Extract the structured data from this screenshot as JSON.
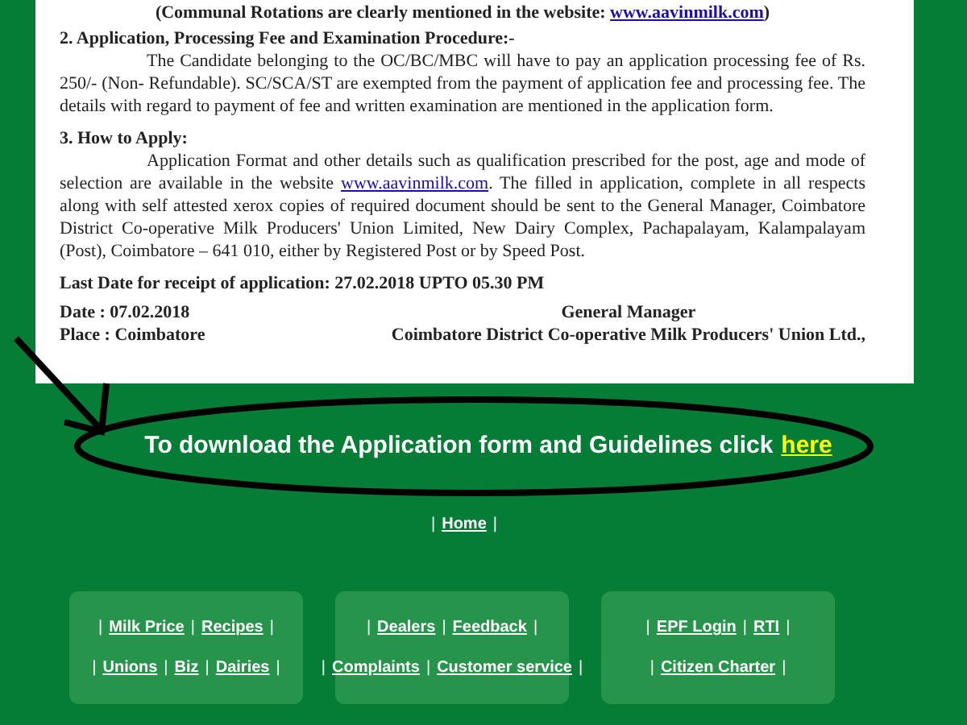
{
  "document": {
    "top_line": {
      "text_before": "(Communal Rotations are clearly mentioned in the website: ",
      "link": "www.aavinmilk.com",
      "text_after": ")"
    },
    "sections": [
      {
        "heading": "2. Application, Processing Fee and Examination Procedure:-",
        "text_before": "The Candidate belonging to the OC/BC/MBC will have to pay an application processing fee of Rs. 250/- (Non- Refundable). SC/SCA/ST are exempted from the payment of application fee and processing fee. The details with regard to payment of fee and written examination are mentioned in the application form."
      },
      {
        "heading": "3. How to Apply:",
        "text_before": "Application Format and other details such as qualification prescribed for the post, age and mode of selection are available in the website ",
        "link": "www.aavinmilk.com",
        "text_after": ". The filled in application, complete in all respects along with self attested xerox copies of required document should be sent to the General Manager, Coimbatore District Co-operative Milk Producers' Union Limited, New Dairy Complex, Pachapalayam, Kalampalayam (Post),  Coimbatore – 641 010, either by Registered Post or by Speed Post."
      }
    ],
    "last_date": "Last Date for receipt of application:  27.02.2018  UPTO 05.30 PM",
    "date": "Date : 07.02.2018",
    "signatory_title": "General Manager",
    "place": "Place : Coimbatore",
    "signatory_org": "Coimbatore District Co-operative Milk Producers' Union Ltd.,"
  },
  "download": {
    "text": "To download the Application form and Guidelines click",
    "link": "here"
  },
  "home_nav": [
    {
      "kind": "separator",
      "text": "|"
    },
    {
      "kind": "link",
      "text": "Home"
    },
    {
      "kind": "separator",
      "text": "|"
    }
  ],
  "footer_boxes": [
    {
      "lines": [
        {
          "items": [
            {
              "kind": "separator",
              "text": "|"
            },
            {
              "kind": "link",
              "text": "Milk Price"
            },
            {
              "kind": "separator",
              "text": "|"
            },
            {
              "kind": "link",
              "text": "Recipes"
            },
            {
              "kind": "separator",
              "text": "|"
            }
          ]
        },
        {
          "items": [
            {
              "kind": "separator",
              "text": "|"
            },
            {
              "kind": "link",
              "text": "Unions"
            },
            {
              "kind": "separator",
              "text": "|"
            },
            {
              "kind": "link",
              "text": "Biz"
            },
            {
              "kind": "separator",
              "text": "|"
            },
            {
              "kind": "link",
              "text": "Dairies"
            },
            {
              "kind": "separator",
              "text": "|"
            }
          ]
        }
      ]
    },
    {
      "lines": [
        {
          "items": [
            {
              "kind": "separator",
              "text": "|"
            },
            {
              "kind": "link",
              "text": "Dealers"
            },
            {
              "kind": "separator",
              "text": "|"
            },
            {
              "kind": "link",
              "text": "Feedback"
            },
            {
              "kind": "separator",
              "text": "|"
            }
          ]
        },
        {
          "items": [
            {
              "kind": "separator",
              "text": "|"
            },
            {
              "kind": "link",
              "text": "Complaints"
            },
            {
              "kind": "separator",
              "text": "|"
            },
            {
              "kind": "link",
              "text": "Customer service"
            },
            {
              "kind": "separator",
              "text": "|"
            }
          ]
        }
      ]
    },
    {
      "lines": [
        {
          "items": [
            {
              "kind": "separator",
              "text": "|"
            },
            {
              "kind": "link",
              "text": "EPF Login"
            },
            {
              "kind": "separator",
              "text": "|"
            },
            {
              "kind": "link",
              "text": "RTI"
            },
            {
              "kind": "separator",
              "text": "|"
            }
          ]
        },
        {
          "items": [
            {
              "kind": "separator",
              "text": "|"
            },
            {
              "kind": "link",
              "text": "Citizen Charter"
            },
            {
              "kind": "separator",
              "text": "|"
            }
          ]
        }
      ]
    }
  ]
}
